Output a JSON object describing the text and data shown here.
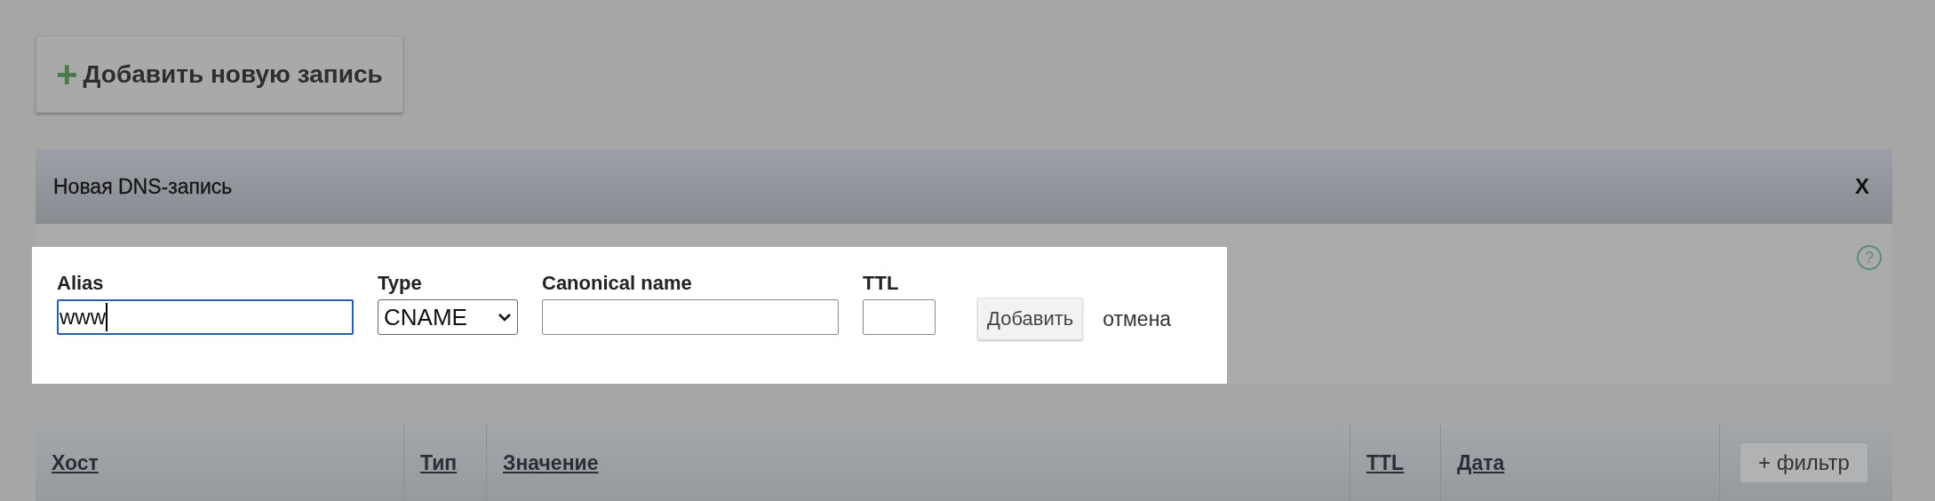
{
  "add_button": {
    "icon": "+",
    "label": "Добавить новую запись"
  },
  "panel": {
    "title": "Новая DNS-запись",
    "close": "X",
    "form": {
      "fields": [
        {
          "kind": "text",
          "label": "Alias",
          "value": "www",
          "focused": true
        },
        {
          "kind": "select",
          "label": "Type",
          "value": "CNAME",
          "focused": false
        },
        {
          "kind": "text",
          "label": "Canonical name",
          "focused": false
        },
        {
          "kind": "short",
          "label": "TTL",
          "focused": false
        }
      ],
      "submit": "Добавить",
      "cancel": "отмена"
    },
    "help": "?"
  },
  "table": {
    "columns": [
      {
        "label": "Хост"
      },
      {
        "label": "Тип"
      },
      {
        "label": "Значение"
      },
      {
        "label": "TTL"
      },
      {
        "label": "Дата"
      }
    ],
    "filter_button": "+ фильтр"
  }
}
